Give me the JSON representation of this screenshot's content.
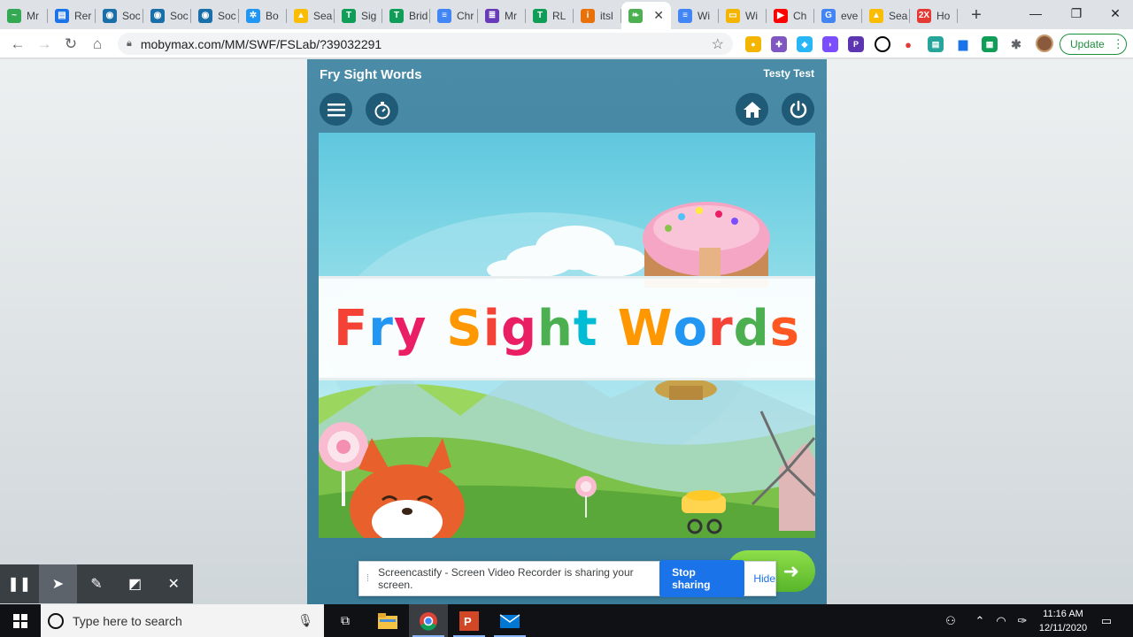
{
  "browser": {
    "tabs": [
      {
        "label": "Mr",
        "color": "#34a853",
        "glyph": "~"
      },
      {
        "label": "Rer",
        "color": "#1a73e8",
        "glyph": "▤"
      },
      {
        "label": "Soc",
        "color": "#1b6fa8",
        "glyph": "◉"
      },
      {
        "label": "Soc",
        "color": "#1b6fa8",
        "glyph": "◉"
      },
      {
        "label": "Soc",
        "color": "#1b6fa8",
        "glyph": "◉"
      },
      {
        "label": "Bo",
        "color": "#2196f3",
        "glyph": "✲"
      },
      {
        "label": "Sea",
        "color": "#fbbc04",
        "glyph": "▲"
      },
      {
        "label": "Sig",
        "color": "#0f9d58",
        "glyph": "T"
      },
      {
        "label": "Brid",
        "color": "#0f9d58",
        "glyph": "T"
      },
      {
        "label": "Chr",
        "color": "#4285f4",
        "glyph": "≡"
      },
      {
        "label": "Mr",
        "color": "#673ab7",
        "glyph": "≣"
      },
      {
        "label": "RL",
        "color": "#0f9d58",
        "glyph": "T"
      },
      {
        "label": "itsl",
        "color": "#e8710a",
        "glyph": "i"
      }
    ],
    "active_tab": {
      "label": "",
      "color": "#4caf50",
      "glyph": "❧"
    },
    "tabs_after": [
      {
        "label": "Wi",
        "color": "#4285f4",
        "glyph": "≡"
      },
      {
        "label": "Wi",
        "color": "#f4b400",
        "glyph": "▭"
      },
      {
        "label": "Ch",
        "color": "#ff0000",
        "glyph": "▶"
      },
      {
        "label": "eve",
        "color": "#4285f4",
        "glyph": "G"
      },
      {
        "label": "Sea",
        "color": "#fbbc04",
        "glyph": "▲"
      },
      {
        "label": "Ho",
        "color": "#e53935",
        "glyph": "2X"
      }
    ],
    "url": "mobymax.com/MM/SWF/FSLab/?39032291",
    "update_label": "Update"
  },
  "app": {
    "title": "Fry Sight Words",
    "user": "Testy Test",
    "banner_words": [
      [
        {
          "t": "F",
          "c": "#f44336"
        },
        {
          "t": "r",
          "c": "#2196f3"
        },
        {
          "t": "y",
          "c": "#e91e63"
        }
      ],
      [
        {
          "t": "S",
          "c": "#ff9800"
        },
        {
          "t": "i",
          "c": "#f44336"
        },
        {
          "t": "g",
          "c": "#e91e63"
        },
        {
          "t": "h",
          "c": "#4caf50"
        },
        {
          "t": "t",
          "c": "#00bcd4"
        }
      ],
      [
        {
          "t": "W",
          "c": "#ff9800"
        },
        {
          "t": "o",
          "c": "#2196f3"
        },
        {
          "t": "r",
          "c": "#f44336"
        },
        {
          "t": "d",
          "c": "#4caf50"
        },
        {
          "t": "s",
          "c": "#ff5722"
        }
      ]
    ]
  },
  "screencastify": {
    "message": "Screencastify - Screen Video Recorder is sharing your screen.",
    "stop_label": "Stop sharing",
    "hide_label": "Hide"
  },
  "taskbar": {
    "search_placeholder": "Type here to search",
    "time": "11:16 AM",
    "date": "12/11/2020"
  }
}
